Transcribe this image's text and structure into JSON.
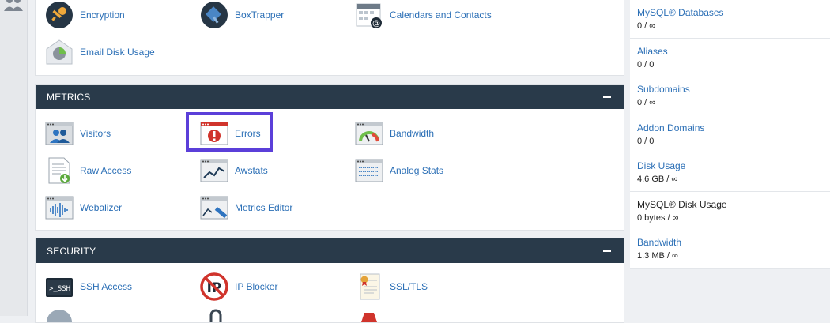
{
  "general": {
    "items": [
      {
        "label": "Encryption",
        "icon": "key-icon"
      },
      {
        "label": "BoxTrapper",
        "icon": "boxtrapper-icon"
      },
      {
        "label": "Calendars and Contacts",
        "icon": "calendar-icon"
      },
      {
        "label": "Email Disk Usage",
        "icon": "envelope-chart-icon"
      }
    ]
  },
  "metrics": {
    "title": "METRICS",
    "items": [
      {
        "label": "Visitors",
        "icon": "visitors-icon"
      },
      {
        "label": "Errors",
        "icon": "error-icon"
      },
      {
        "label": "Bandwidth",
        "icon": "gauge-icon"
      },
      {
        "label": "Raw Access",
        "icon": "raw-access-icon"
      },
      {
        "label": "Awstats",
        "icon": "line-chart-icon"
      },
      {
        "label": "Analog Stats",
        "icon": "analog-stats-icon"
      },
      {
        "label": "Webalizer",
        "icon": "waveform-icon"
      },
      {
        "label": "Metrics Editor",
        "icon": "metrics-editor-icon"
      }
    ]
  },
  "security": {
    "title": "SECURITY",
    "items": [
      {
        "label": "SSH Access",
        "icon": "terminal-icon"
      },
      {
        "label": "IP Blocker",
        "icon": "ip-blocker-icon"
      },
      {
        "label": "SSL/TLS",
        "icon": "certificate-icon"
      }
    ]
  },
  "stats": [
    {
      "label": "MySQL® Databases",
      "value": "0 / ∞"
    },
    {
      "label": "Aliases",
      "value": "0 / 0"
    },
    {
      "label": "Subdomains",
      "value": "0 / ∞"
    },
    {
      "label": "Addon Domains",
      "value": "0 / 0"
    },
    {
      "label": "Disk Usage",
      "value": "4.6 GB / ∞"
    },
    {
      "label": "MySQL® Disk Usage",
      "value": "0 bytes / ∞"
    },
    {
      "label": "Bandwidth",
      "value": "1.3 MB / ∞"
    }
  ],
  "colors": {
    "header": "#293a4a",
    "link": "#2b6fb6",
    "highlight": "#5b3fd9",
    "error_red": "#d0342c"
  }
}
